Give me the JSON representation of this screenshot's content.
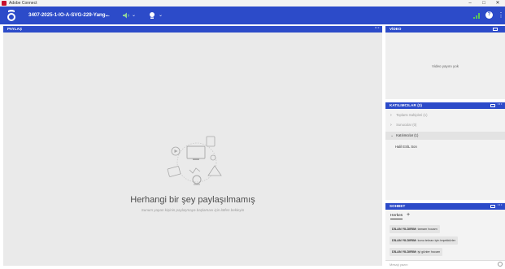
{
  "window": {
    "title": "Adobe Connect",
    "controls": {
      "minimize": "–",
      "maximize": "□",
      "close": "✕"
    }
  },
  "header": {
    "meeting_name": "3407-2025-1-IO-A-SVG-229-Yang...",
    "meeting_chevron": "⌄",
    "mic_chevron": "⌄",
    "cam_chevron": "⌄",
    "help": "?",
    "menu": "⋮",
    "colors": {
      "bar": "#2c4bc9",
      "signal": "#5ac35a"
    }
  },
  "share_pod": {
    "title": "PAYLAŞ",
    "more": "···",
    "empty_title": "Herhangi bir şey paylaşılmamış",
    "empty_subtitle": "Sunum yapan kişinin paylaşmaya başlaması için lütfen bekleyin"
  },
  "video_pod": {
    "title": "VİDEO",
    "empty_text": "Video yayını yok"
  },
  "attendees_pod": {
    "title": "KATILIMCILAR (3)",
    "more": "···",
    "groups": [
      {
        "label": "Toplantı Sahipleri (1)",
        "chevron": "›"
      },
      {
        "label": "Sunucular (0)",
        "chevron": "›"
      },
      {
        "label": "Katılımcılar (1)",
        "chevron": "⌄"
      }
    ],
    "users": [
      "Halil ESİL Son"
    ]
  },
  "chat_pod": {
    "title": "SOHBET",
    "more": "···",
    "tab": "Herkes",
    "add_tab": "+",
    "messages": [
      {
        "sender": "DİLAN YILDIRIM:",
        "text": "tamam hocam"
      },
      {
        "sender": "DİLAN YILDIRIM:",
        "text": "konu tekrarı için teşekkürler"
      },
      {
        "sender": "DİLAN YILDIRIM:",
        "text": "iyi günler hocam"
      }
    ],
    "input_placeholder": "Mesajı yazın"
  }
}
